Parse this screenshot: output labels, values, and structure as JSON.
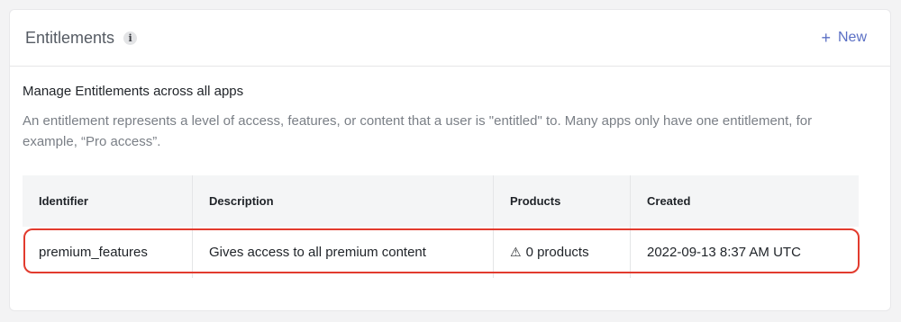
{
  "header": {
    "title": "Entitlements",
    "info_glyph": "i",
    "new_plus": "+",
    "new_label": "New"
  },
  "section": {
    "title": "Manage Entitlements across all apps",
    "description": "An entitlement represents a level of access, features, or content that a user is \"entitled\" to. Many apps only have one entitlement, for example, “Pro access”."
  },
  "table": {
    "columns": [
      "Identifier",
      "Description",
      "Products",
      "Created"
    ],
    "rows": [
      {
        "identifier": "premium_features",
        "description": "Gives access to all premium content",
        "products_icon": "⚠",
        "products": "0 products",
        "created": "2022-09-13 8:37 AM UTC"
      }
    ]
  },
  "colors": {
    "accent": "#5a6fc4",
    "highlight": "#e23b2e"
  },
  "icons": {
    "info": "info-icon",
    "plus": "plus-icon",
    "warning": "warning-icon"
  }
}
